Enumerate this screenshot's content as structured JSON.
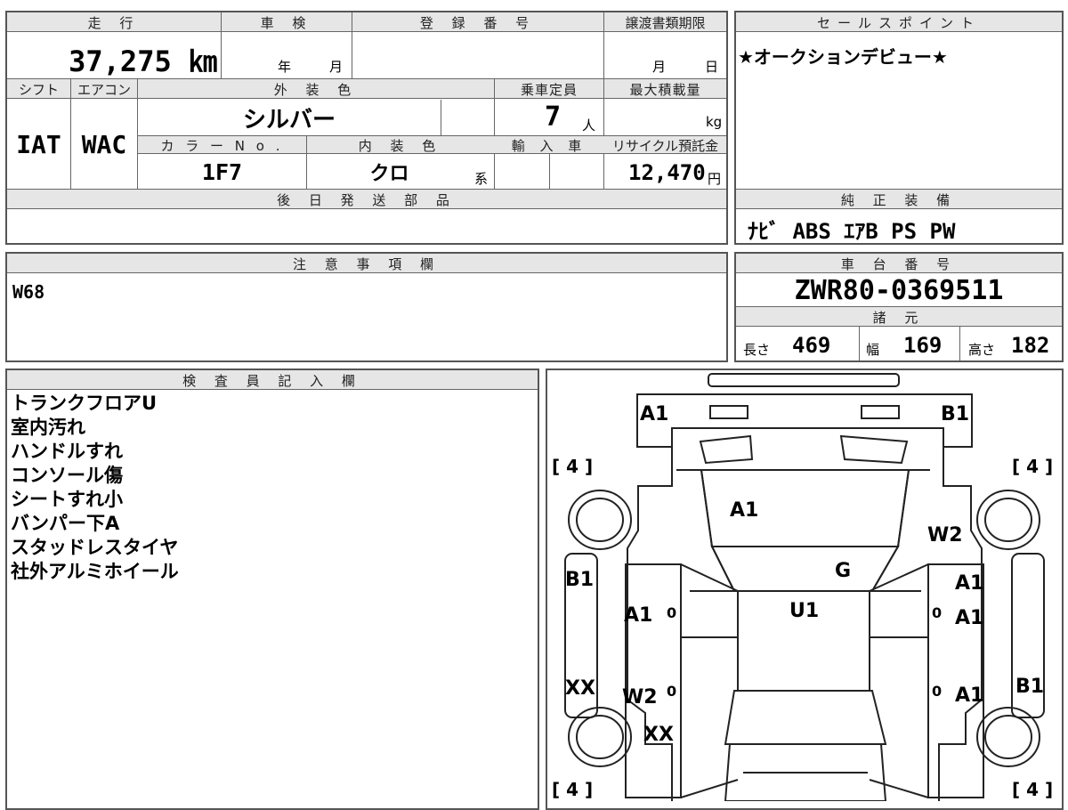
{
  "mileage": {
    "header": "走 行",
    "value": "37,275 ㎞"
  },
  "shaken": {
    "header": "車 検",
    "year": "年",
    "month": "月"
  },
  "registration": {
    "header": "登 録 番 号",
    "value": ""
  },
  "transfer_deadline": {
    "header": "譲渡書類期限",
    "month": "月",
    "day": "日"
  },
  "shift": {
    "header": "シフト",
    "value": "IAT"
  },
  "aircon": {
    "header": "エアコン",
    "value": "WAC"
  },
  "exterior_color": {
    "header": "外 装 色",
    "value": "シルバー"
  },
  "capacity": {
    "header": "乗車定員",
    "value": "7",
    "unit": "人"
  },
  "max_load": {
    "header": "最大積載量",
    "unit": "kg"
  },
  "color_no": {
    "header": "カ ラ ー N o .",
    "value": "1F7"
  },
  "interior_color": {
    "header": "内 装 色",
    "value": "クロ",
    "suffix": "系"
  },
  "import": {
    "header": "輸 入 車"
  },
  "recycle": {
    "header": "リサイクル預託金",
    "value": "12,470",
    "unit": "円"
  },
  "later_parts": {
    "header": "後 日 発 送 部 品"
  },
  "sales_point": {
    "header": "セールスポイント",
    "value": "★オークションデビュー★"
  },
  "genuine_equipment": {
    "header": "純 正 装 備",
    "value": "ﾅﾋﾞ ABS ｴｱB PS PW"
  },
  "notes": {
    "header": "注 意 事 項 欄",
    "value": "W68"
  },
  "chassis_no": {
    "header": "車 台 番 号",
    "value": "ZWR80-0369511"
  },
  "specs": {
    "header": "諸 元",
    "length_label": "長さ",
    "length": "469",
    "width_label": "幅",
    "width": "169",
    "height_label": "高さ",
    "height": "182"
  },
  "inspector": {
    "header": "検 査 員 記 入 欄",
    "remarks": [
      "トランクフロアU",
      "室内汚れ",
      "ハンドルすれ",
      "コンソール傷",
      "シートすれ小",
      "バンパー下A",
      "スタッドレスタイヤ",
      "社外アルミホイール"
    ]
  },
  "diagram": {
    "marks": [
      "A1",
      "B1",
      "A1",
      "W2",
      "G",
      "B1",
      "A1",
      "A1",
      "U1",
      "A1",
      "XX",
      "W2",
      "A1",
      "B1",
      "XX"
    ],
    "tires": [
      "[ 4 ]",
      "[ 4 ]",
      "[ 4 ]",
      "[ 4 ]"
    ],
    "tread": [
      "0",
      "0",
      "0",
      "0"
    ]
  }
}
